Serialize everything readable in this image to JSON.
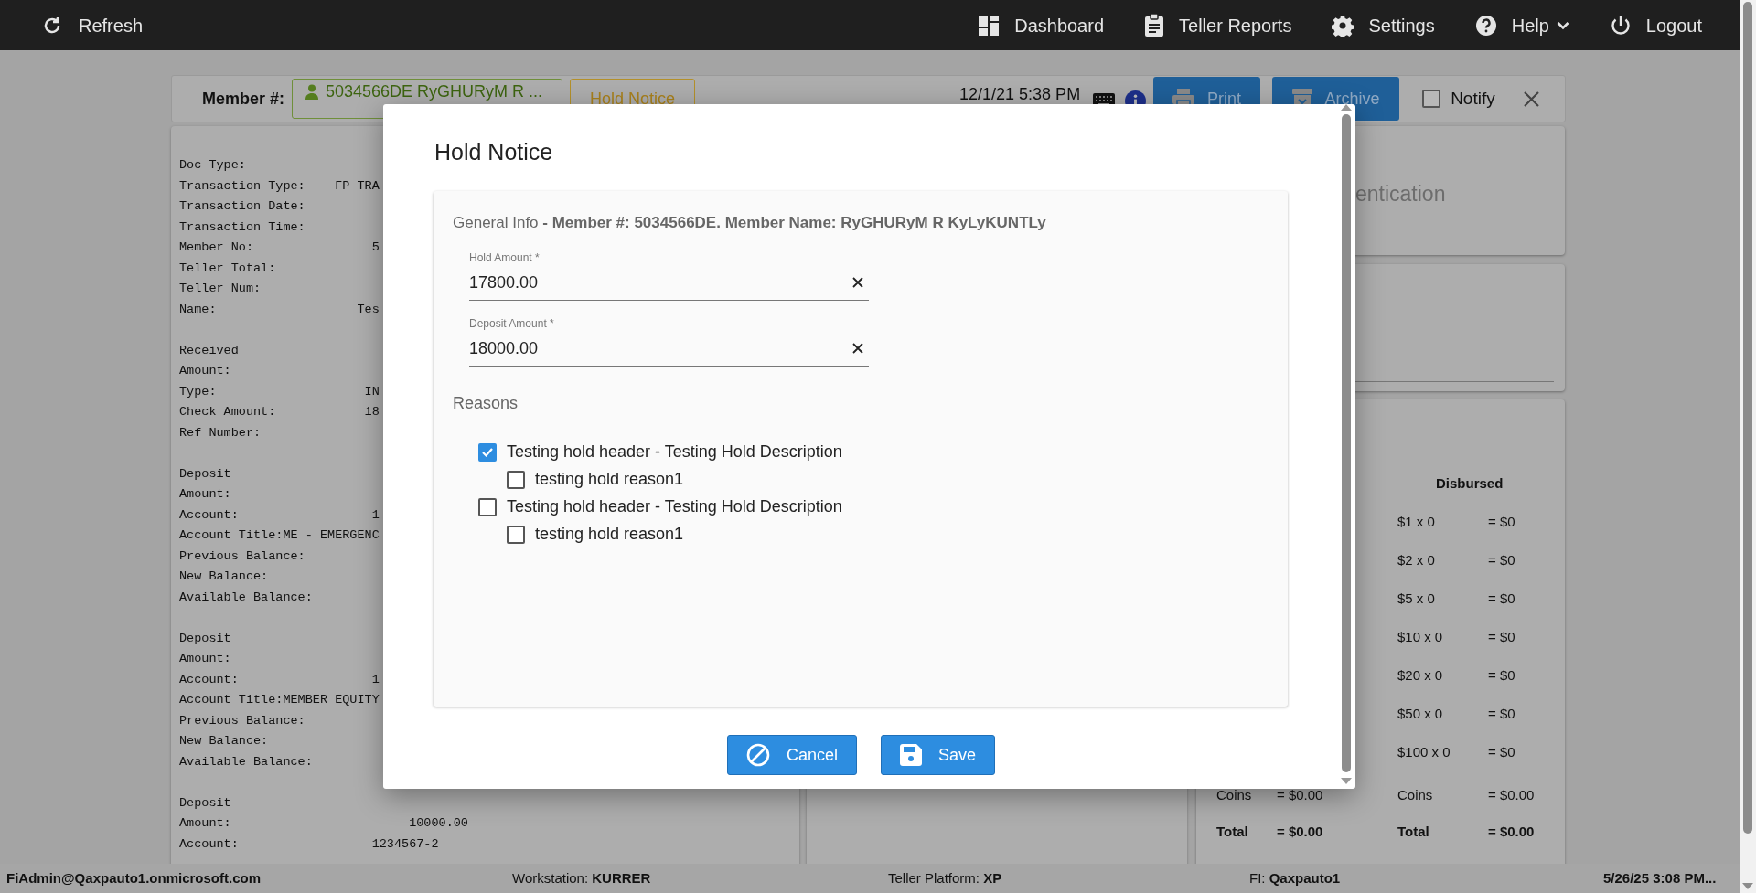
{
  "nav": {
    "left": [
      {
        "kind": "refresh",
        "label": "Refresh"
      }
    ],
    "right": [
      {
        "kind": "dashboard",
        "label": "Dashboard",
        "dropdown": false
      },
      {
        "kind": "reports",
        "label": "Teller Reports",
        "dropdown": false
      },
      {
        "kind": "settings",
        "label": "Settings",
        "dropdown": false
      },
      {
        "kind": "help",
        "label": "Help",
        "dropdown": true
      },
      {
        "kind": "logout",
        "label": "Logout",
        "dropdown": false
      }
    ]
  },
  "member_bar": {
    "label": "Member #:",
    "member": "5034566DE RyGHURyM R ...",
    "hold_notice": "Hold Notice",
    "datetime": "12/1/21 5:38 PM",
    "buttons": [
      {
        "kind": "print",
        "label": "Print"
      },
      {
        "kind": "archive",
        "label": "Archive"
      }
    ],
    "notify": {
      "label": "Notify",
      "checked": false
    }
  },
  "receipt": {
    "sections": [
      [
        "Doc Type:",
        "Transaction Type:    FP TRA",
        "Transaction Date:",
        "Transaction Time:",
        "Member No:                5",
        "Teller Total:",
        "Teller Num:",
        "Name:                   Tes"
      ],
      [
        "Received",
        "Amount:",
        "Type:                    IN",
        "Check Amount:            18",
        "Ref Number:"
      ],
      [
        "Deposit",
        "Amount:",
        "Account:                  1",
        "Account Title:ME - EMERGENC",
        "Previous Balance:",
        "New Balance:",
        "Available Balance:"
      ],
      [
        "Deposit",
        "Amount:",
        "Account:                  1",
        "Account Title:MEMBER EQUITY",
        "Previous Balance:",
        "New Balance:",
        "Available Balance:"
      ],
      [
        "Deposit",
        "Amount:                        10000.00",
        "Account:                  1234567-2"
      ]
    ]
  },
  "auth_card": {
    "title": "entication"
  },
  "cash_card": {
    "header": "Disbursed",
    "rows": [
      {
        "label": "$1 x 0",
        "amount": "= $0"
      },
      {
        "label": "$2 x 0",
        "amount": "= $0"
      },
      {
        "label": "$5 x 0",
        "amount": "= $0"
      },
      {
        "label": "$10 x 0",
        "amount": "= $0"
      },
      {
        "label": "$20 x 0",
        "amount": "= $0"
      },
      {
        "label": "$50 x 0",
        "amount": "= $0"
      },
      {
        "label": "$100 x 0",
        "amount": "= $0"
      }
    ],
    "summary": [
      {
        "kind": "coins",
        "cells": [
          "Coins",
          "= $0.00",
          "Coins",
          "= $0.00"
        ]
      },
      {
        "kind": "total",
        "cells": [
          "Total",
          "= $0.00",
          "Total",
          "= $0.00"
        ]
      }
    ]
  },
  "modal": {
    "title": "Hold Notice",
    "info": "General Info **- Member #: 5034566DE. Member Name: RyGHURyM R KyLyKUNTLy**",
    "fields": [
      {
        "label": "Hold Amount *",
        "value": "17800.00"
      },
      {
        "label": "Deposit Amount *",
        "value": "18000.00"
      }
    ],
    "reasons_title": "Reasons",
    "reasons": [
      {
        "label": "Testing hold header - Testing Hold Description",
        "checked": true,
        "children": [
          {
            "label": "testing hold reason1",
            "checked": false
          }
        ]
      },
      {
        "label": "Testing hold header - Testing Hold Description",
        "checked": false,
        "children": [
          {
            "label": "testing hold reason1",
            "checked": false
          }
        ]
      }
    ],
    "buttons": [
      {
        "kind": "cancel",
        "label": "Cancel"
      },
      {
        "kind": "save",
        "label": "Save"
      }
    ]
  },
  "status_bar": {
    "user": "FiAdmin@Qaxpauto1.onmicrosoft.com",
    "items": [
      "Workstation: **KURRER**",
      "Teller Platform: **XP**",
      "FI: **Qaxpauto1**"
    ],
    "time": "5/26/25 3:08 PM..."
  }
}
